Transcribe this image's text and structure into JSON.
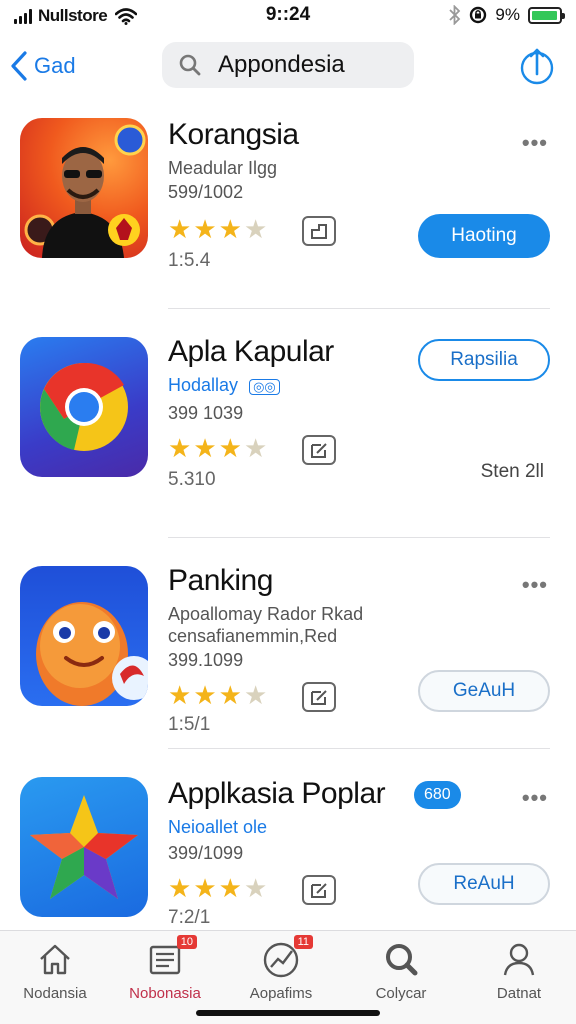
{
  "status_bar": {
    "carrier": "Nullstore",
    "time": "9::24",
    "battery_pct": "9%",
    "battery_level": 0.95
  },
  "nav": {
    "back_label": "Gad",
    "search_value": "Appondesia"
  },
  "apps": [
    {
      "name": "Korangsia",
      "subtitle": "Meadular Ilgg",
      "meta": "599/1002",
      "rating": 3.5,
      "count": "1:5.4",
      "button_label": "Haoting",
      "button_style": "solid"
    },
    {
      "name": "Apla Kapular",
      "subtitle": "Hodallay",
      "meta": "399 1039",
      "rating": 3.5,
      "count": "5.310",
      "button_label": "Rapsilia",
      "button_style": "outline-blue",
      "side_note": "Sten 2ll"
    },
    {
      "name": "Panking",
      "subtitle": "Apoallomay Rador Rkad",
      "subtitle2": "censafianemmin,Red",
      "meta": "399.1099",
      "rating": 3.5,
      "count": "1:5/1",
      "button_label": "GeAuH",
      "button_style": "outline-grey"
    },
    {
      "name": "Applkasia Poplar",
      "badge": "680",
      "subtitle": "Neioallet ole",
      "meta": "399/1099",
      "rating": 3.5,
      "count": "7:2/1",
      "button_label": "ReAuH",
      "button_style": "outline-grey"
    }
  ],
  "tab_bar": {
    "tabs": [
      {
        "label": "Nodansia",
        "icon": "home-icon",
        "active": false
      },
      {
        "label": "Nobonasia",
        "icon": "news-icon",
        "active": true,
        "badge": "10"
      },
      {
        "label": "Aopafims",
        "icon": "chart-icon",
        "active": false,
        "badge": "11"
      },
      {
        "label": "Colycar",
        "icon": "search-icon",
        "active": false
      },
      {
        "label": "Datnat",
        "icon": "person-icon",
        "active": false
      }
    ]
  },
  "colors": {
    "accent": "#1a8ae8",
    "star": "#f4b41a",
    "battery": "#34c759",
    "active_tab": "#c0304a"
  }
}
